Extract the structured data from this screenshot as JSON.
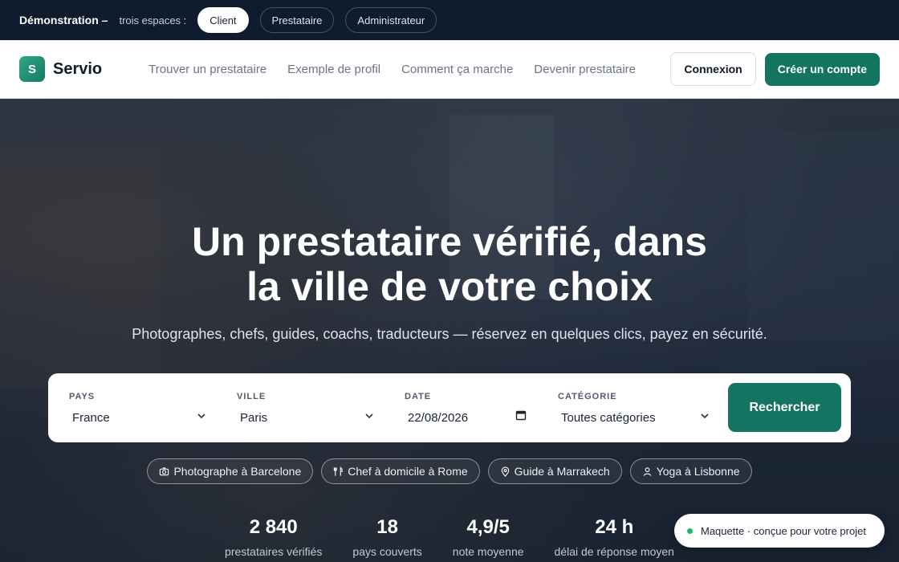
{
  "demo_bar": {
    "title": "Démonstration –",
    "subtitle": "trois espaces :",
    "spaces": [
      "Client",
      "Prestataire",
      "Administrateur"
    ],
    "active": "Client"
  },
  "nav": {
    "logo_letter": "S",
    "brand": "Servio",
    "links": [
      "Trouver un prestataire",
      "Exemple de profil",
      "Comment ça marche",
      "Devenir prestataire"
    ],
    "login": "Connexion",
    "signup": "Créer un compte"
  },
  "hero": {
    "headline_line1": "Un prestataire vérifié, dans",
    "headline_line2": "la ville de votre choix",
    "subtitle": "Photographes, chefs, guides, coachs, traducteurs — réservez en quelques clics, payez en sécurité."
  },
  "search": {
    "country_label": "PAYS",
    "country_value": "France",
    "city_label": "VILLE",
    "city_value": "Paris",
    "date_label": "DATE",
    "date_value": "22/08/2026",
    "category_label": "CATÉGORIE",
    "category_value": "Toutes catégories",
    "button": "Rechercher"
  },
  "chips": [
    {
      "icon": "camera-icon",
      "label": "Photographe à Barcelone"
    },
    {
      "icon": "utensils-icon",
      "label": "Chef à domicile à Rome"
    },
    {
      "icon": "map-pin-icon",
      "label": "Guide à Marrakech"
    },
    {
      "icon": "user-icon",
      "label": "Yoga à Lisbonne"
    }
  ],
  "stats": [
    {
      "value": "2 840",
      "label": "prestataires vérifiés"
    },
    {
      "value": "18",
      "label": "pays couverts"
    },
    {
      "value": "4,9/5",
      "label": "note moyenne"
    },
    {
      "value": "24 h",
      "label": "délai de réponse moyen"
    }
  ],
  "toast": "Maquette · conçue pour votre projet",
  "colors": {
    "primary": "#137461",
    "dark": "#0f1c2e",
    "status": "#28b26a"
  }
}
